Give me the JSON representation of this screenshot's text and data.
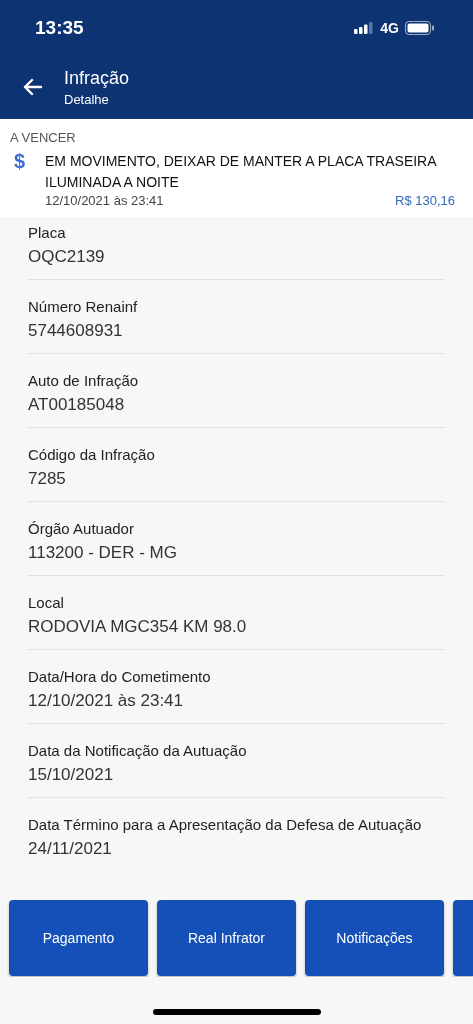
{
  "status_bar": {
    "time": "13:35",
    "network": "4G"
  },
  "header": {
    "title": "Infração",
    "subtitle": "Detalhe"
  },
  "summary": {
    "status": "A VENCER",
    "icon": "$",
    "description": "EM MOVIMENTO, DEIXAR DE MANTER A PLACA TRASEIRA ILUMINADA A NOITE",
    "datetime": "12/10/2021 às 23:41",
    "amount": "R$ 130,16"
  },
  "fields": [
    {
      "label": "Placa",
      "value": "OQC2139"
    },
    {
      "label": "Número Renainf",
      "value": "5744608931"
    },
    {
      "label": "Auto de Infração",
      "value": "AT00185048"
    },
    {
      "label": "Código da Infração",
      "value": "7285"
    },
    {
      "label": "Órgão Autuador",
      "value": "113200 - DER - MG"
    },
    {
      "label": "Local",
      "value": "RODOVIA  MGC354 KM  98.0"
    },
    {
      "label": "Data/Hora do Cometimento",
      "value": "12/10/2021 às 23:41"
    },
    {
      "label": "Data da Notificação da Autuação",
      "value": "15/10/2021"
    },
    {
      "label": "Data Término para a Apresentação da Defesa de Autuação",
      "value": "24/11/2021"
    }
  ],
  "buttons": [
    "Pagamento",
    "Real Infrator",
    "Notificações"
  ]
}
